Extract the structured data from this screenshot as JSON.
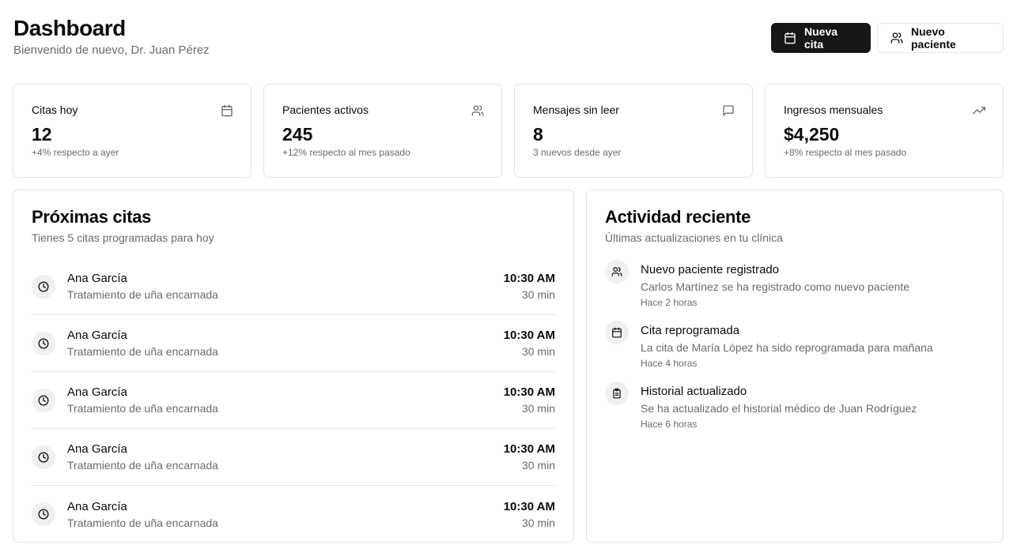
{
  "header": {
    "title": "Dashboard",
    "subtitle": "Bienvenido de nuevo, Dr. Juan Pérez"
  },
  "actions": {
    "new_appointment": "Nueva cita",
    "new_patient": "Nuevo paciente"
  },
  "stats": [
    {
      "label": "Citas hoy",
      "value": "12",
      "note": "+4% respecto a ayer",
      "icon": "calendar-icon"
    },
    {
      "label": "Pacientes activos",
      "value": "245",
      "note": "+12% respecto al mes pasado",
      "icon": "users-icon"
    },
    {
      "label": "Mensajes sin leer",
      "value": "8",
      "note": "3 nuevos desde ayer",
      "icon": "message-icon"
    },
    {
      "label": "Ingresos mensuales",
      "value": "$4,250",
      "note": "+8% respecto al mes pasado",
      "icon": "trending-up-icon"
    }
  ],
  "appointments": {
    "title": "Próximas citas",
    "description": "Tienes 5 citas programadas para hoy",
    "items": [
      {
        "name": "Ana García",
        "treatment": "Tratamiento de uña encarnada",
        "time": "10:30 AM",
        "duration": "30 min"
      },
      {
        "name": "Ana García",
        "treatment": "Tratamiento de uña encarnada",
        "time": "10:30 AM",
        "duration": "30 min"
      },
      {
        "name": "Ana García",
        "treatment": "Tratamiento de uña encarnada",
        "time": "10:30 AM",
        "duration": "30 min"
      },
      {
        "name": "Ana García",
        "treatment": "Tratamiento de uña encarnada",
        "time": "10:30 AM",
        "duration": "30 min"
      },
      {
        "name": "Ana García",
        "treatment": "Tratamiento de uña encarnada",
        "time": "10:30 AM",
        "duration": "30 min"
      }
    ]
  },
  "activity": {
    "title": "Actividad reciente",
    "description": "Últimas actualizaciones en tu clínica",
    "items": [
      {
        "title": "Nuevo paciente registrado",
        "description": "Carlos Martínez se ha registrado como nuevo paciente",
        "time": "Hace 2 horas",
        "icon": "users-icon"
      },
      {
        "title": "Cita reprogramada",
        "description": "La cita de María López ha sido reprogramada para mañana",
        "time": "Hace 4 horas",
        "icon": "calendar-icon"
      },
      {
        "title": "Historial actualizado",
        "description": "Se ha actualizado el historial médico de Juan Rodríguez",
        "time": "Hace 6 horas",
        "icon": "clipboard-icon"
      }
    ]
  }
}
